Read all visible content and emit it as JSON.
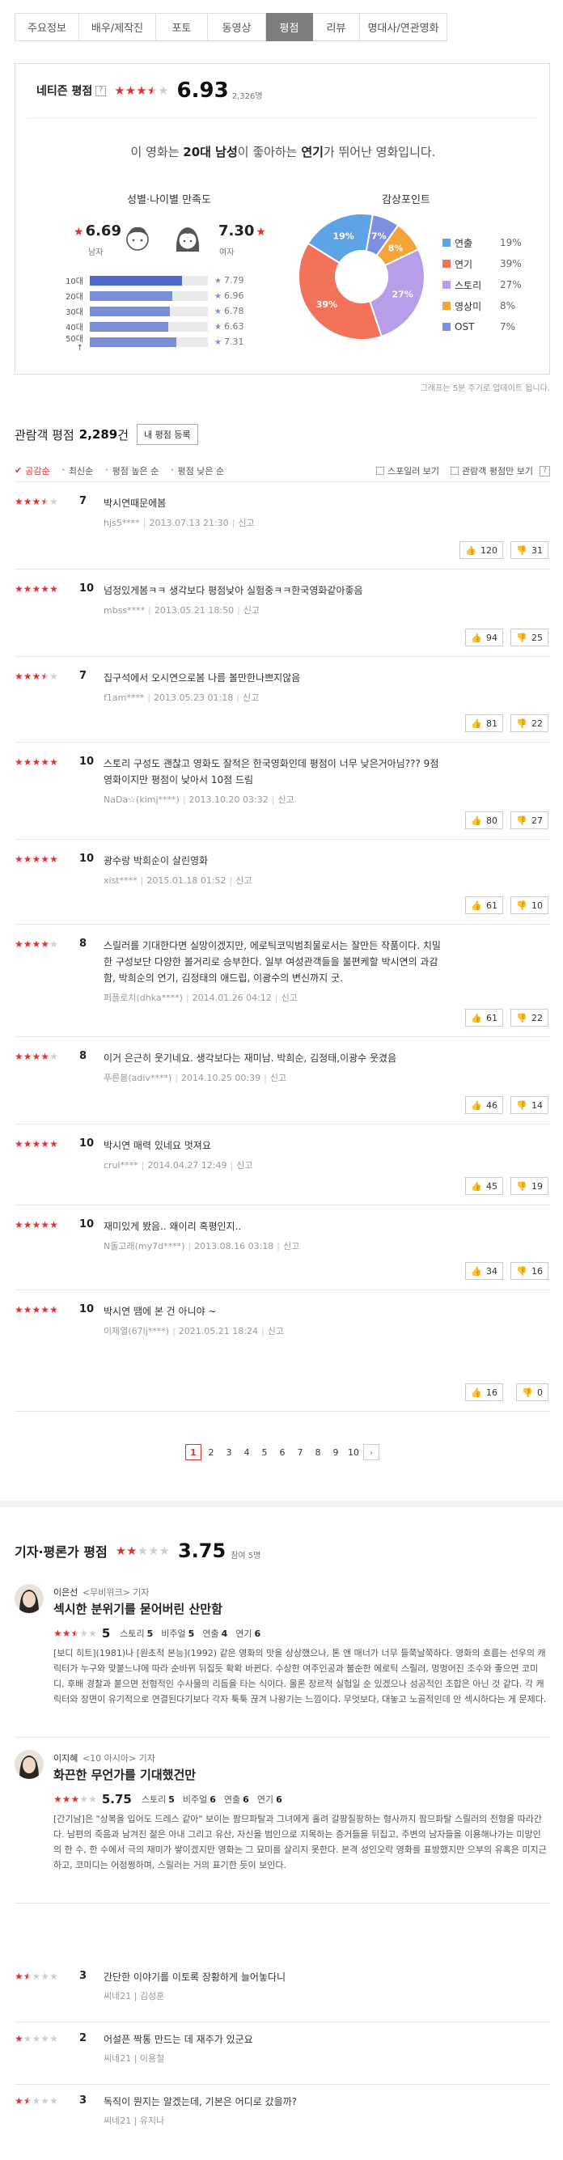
{
  "tabs": [
    {
      "label": "주요정보",
      "active": false
    },
    {
      "label": "배우/제작진",
      "active": false
    },
    {
      "label": "포토",
      "active": false
    },
    {
      "label": "동영상",
      "active": false
    },
    {
      "label": "평점",
      "active": true
    },
    {
      "label": "리뷰",
      "active": false
    },
    {
      "label": "명대사/연관영화",
      "active": false
    }
  ],
  "netizen": {
    "title": "네티즌 평점",
    "help": "?",
    "stars": 3.5,
    "score": "6.93",
    "count": "2,326명",
    "summary_pre": "이 영화는 ",
    "summary_group": "20대 남성",
    "summary_mid": "이 좋아하는 ",
    "summary_point": "연기",
    "summary_post": "가 뛰어난 영화입니다.",
    "demo_title": "성별·나이별 만족도",
    "male_score": "6.69",
    "male_label": "남자",
    "female_score": "7.30",
    "female_label": "여자",
    "ages": [
      {
        "label": "10대",
        "value": "7.79",
        "fraction": 0.779,
        "top": true
      },
      {
        "label": "20대",
        "value": "6.96",
        "fraction": 0.696,
        "top": false
      },
      {
        "label": "30대",
        "value": "6.78",
        "fraction": 0.678,
        "top": false
      },
      {
        "label": "40대",
        "value": "6.63",
        "fraction": 0.663,
        "top": false
      },
      {
        "label": "50대↑",
        "value": "7.31",
        "fraction": 0.731,
        "top": false
      }
    ],
    "kp_title": "감상포인트",
    "points": [
      {
        "name": "연출",
        "pct": "19%",
        "value": 19,
        "color": "#5ea3e3"
      },
      {
        "name": "연기",
        "pct": "39%",
        "value": 39,
        "color": "#f2735a"
      },
      {
        "name": "스토리",
        "pct": "27%",
        "value": 27,
        "color": "#b89ee8"
      },
      {
        "name": "영상미",
        "pct": "8%",
        "value": 8,
        "color": "#f5a43a"
      },
      {
        "name": "OST",
        "pct": "7%",
        "value": 7,
        "color": "#7f8fe0"
      }
    ],
    "note": "그래프는 5분 주기로 업데이트 됩니다."
  },
  "audience": {
    "title": "관람객 평점",
    "count": "2,289",
    "unit": "건",
    "register": "내 평점 등록",
    "sorts": [
      {
        "label": "공감순",
        "on": true
      },
      {
        "label": "최신순",
        "on": false
      },
      {
        "label": "평점 높은 순",
        "on": false
      },
      {
        "label": "평점 낮은 순",
        "on": false
      }
    ],
    "spoiler": "스포일러 보기",
    "only": "관람객 평점만 보기",
    "help": "?",
    "report": "신고"
  },
  "reviews": [
    {
      "stars": 3.5,
      "score": "7",
      "text": "박시연때문에봄",
      "user": "hjs5****",
      "date": "2013.07.13 21:30",
      "up": "120",
      "down": "31"
    },
    {
      "stars": 5,
      "score": "10",
      "text": "넘정있게봄ㅋㅋ 생각보다 평점낮아 실험중ㅋㅋ한국영화같아좋음",
      "user": "mbss****",
      "date": "2013.05.21 18:50",
      "up": "94",
      "down": "25"
    },
    {
      "stars": 3.5,
      "score": "7",
      "text": "집구석에서 오시연으로봄 나름 볼만한나쁘지않음",
      "user": "f1am****",
      "date": "2013.05.23 01:18",
      "up": "81",
      "down": "22"
    },
    {
      "stars": 5,
      "score": "10",
      "text": "스토리 구성도 괜찮고 영화도 잘적은 한국영화인데 평점이 너무 낮은거아님??? 9점영화이지만 평점이 낮아서 10점 드림",
      "user": "NaDa☆(kimj****)",
      "date": "2013.10.20 03:32",
      "up": "80",
      "down": "27"
    },
    {
      "stars": 5,
      "score": "10",
      "text": "광수랑 박희순이 살린영화",
      "user": "xist****",
      "date": "2015.01.18 01:52",
      "up": "61",
      "down": "10"
    },
    {
      "stars": 4,
      "score": "8",
      "text": "스릴러를 기대한다면 실망이겠지만, 에로틱코믹범죄물로서는 잘만든 작품이다. 치밀한 구성보단 다양한 볼거리로 승부한다. 일부 여성관객들을 불편케할 박시연의 과감함, 박희순의 연기, 김정태의 애드립, 이광수의 변신까지 굿.",
      "user": "퍼플로치(dhka****)",
      "date": "2014.01.26 04:12",
      "up": "61",
      "down": "22"
    },
    {
      "stars": 4,
      "score": "8",
      "text": "이거 은근히 웃기네요. 생각보다는 재미남. 박희순, 김정태,이광수 웃겼음",
      "user": "푸른봄(adiv****)",
      "date": "2014.10.25 00:39",
      "up": "46",
      "down": "14"
    },
    {
      "stars": 5,
      "score": "10",
      "text": "박시연 매력 있네요 멋져요",
      "user": "crui****",
      "date": "2014.04.27 12:49",
      "up": "45",
      "down": "19"
    },
    {
      "stars": 5,
      "score": "10",
      "text": "재미있게 봤음.. 왜이리 혹평인지..",
      "user": "N돌고래(my7d****)",
      "date": "2013.08.16 03:18",
      "up": "34",
      "down": "16"
    },
    {
      "stars": 5,
      "score": "10",
      "text": "박시연 땜에 본 건 아니야 ~",
      "user": "이제열(67lj****)",
      "date": "2021.05.21 18:24",
      "up": "16",
      "down": "0"
    }
  ],
  "pager": {
    "pages": [
      "1",
      "2",
      "3",
      "4",
      "5",
      "6",
      "7",
      "8",
      "9",
      "10"
    ],
    "current": "1",
    "next": "›"
  },
  "critics": {
    "title": "기자·평론가 평점",
    "stars": 2,
    "score": "3.75",
    "count": "참여 5명",
    "full": [
      {
        "name": "이은선",
        "org": "<무비위크> 기자",
        "headline": "섹시한 분위기를 묻어버린 산만함",
        "stars": 2.5,
        "total": "5",
        "subs": [
          {
            "k": "스토리",
            "v": "5"
          },
          {
            "k": "비주얼",
            "v": "5"
          },
          {
            "k": "연출",
            "v": "4"
          },
          {
            "k": "연기",
            "v": "6"
          }
        ],
        "body": "[보디 히트](1981)나 [원초적 본능](1992) 같은 영화의 맛을 상상했으나, 톤 앤 매너가 너무 들쭉날쭉하다. 영화의 흐름는 선우의 캐릭터가 누구와 맞붙느냐에 따라 순바뀌 뒤집듯 확확 바뀐다. 수상한 여주인공과 불순한 에로틱 스릴러, 멍멍어진 조수와 좋으면 코미디, 후배 경찰과 붙으면 전형적인 수사물의 리듬을 타는 식이다. 몰론 장르적 실험일 순 있겠으나 성공적인 조합은 아닌 것 같다. 각 캐릭터와 장면이 유기적으로 연결된다기보다 각자 툭툭 끊겨 나왕기는 느낌이다. 무엇보다, 대놓고 노골적인데 안 섹시하다는 게 문제다."
      },
      {
        "name": "이지혜",
        "org": "<10 아시아> 기자",
        "headline": "화끈한 무언가를 기대했건만",
        "stars": 3,
        "total": "5.75",
        "subs": [
          {
            "k": "스토리",
            "v": "5"
          },
          {
            "k": "비주얼",
            "v": "6"
          },
          {
            "k": "연출",
            "v": "6"
          },
          {
            "k": "연기",
            "v": "6"
          }
        ],
        "body": "[간기남]은 \"상복을 입어도 드레스 같아\" 보이는 팜므파탈과 그녀에게 홀려 갈팡질팡하는 형사까지 팜므파탈 스릴러의 전형을 따라간다. 남편의 죽음과 남겨진 젊은 아내 그리고 유산, 자신을 범인으로 지목하는 증거들을 뒤집고, 주변의 남자들을 이용해나가는 미망인의 한 수, 한 수에서 극의 재미가 쌓이겠지만 영화는 그 묘미를 살리지 못한다. 본격 성인오락 영화를 표방했지만 으부의 유혹은 미지근하고, 코미디는 어정쩡하며, 스릴러는 거의 표기한 듯이 보인다."
      }
    ],
    "short": [
      {
        "stars": 1.5,
        "score": "3",
        "text": "간단한 이야기를 이토록 장황하게 늘어놓다니",
        "by": "씨네21 | 김성훈"
      },
      {
        "stars": 1,
        "score": "2",
        "text": "어설픈 짝통 만드는 데 재주가 있군요",
        "by": "씨네21 | 이용철"
      },
      {
        "stars": 1.5,
        "score": "3",
        "text": "독직이 뭔지는 알겠는데, 기본은 어디로 갔을까?",
        "by": "씨네21 | 유지나"
      }
    ]
  }
}
